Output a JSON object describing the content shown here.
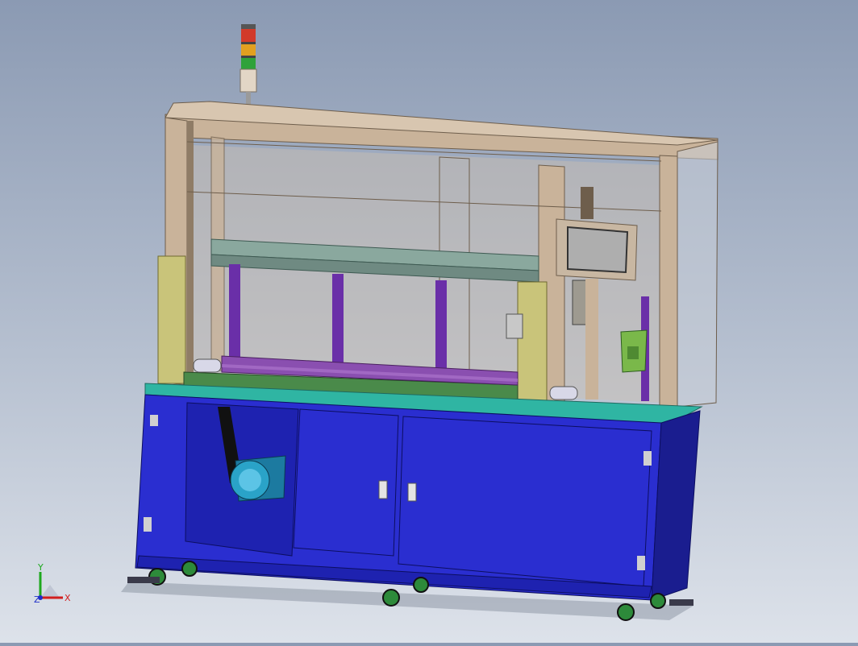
{
  "viewport": {
    "model": "machine-assembly",
    "background": [
      "#8b9ab3",
      "#dde2ea"
    ]
  },
  "colors": {
    "frame": "#c9b39a",
    "frame_dark": "#8f7c66",
    "glass": "rgba(205,190,175,0.45)",
    "cabinet": "#2a2ed0",
    "cabinet_dark": "#1a1d8f",
    "top_plate": "#2fb5a3",
    "conveyor": "#4a8a4a",
    "pillar": "#6a2fa8",
    "rail": "#8aa89e",
    "yellow_post": "#c9c47a",
    "motor": "#2aa3c8",
    "screen": "#aeaeae",
    "wheel": "#2d8a3a",
    "tower_red": "#d23a2a",
    "tower_amber": "#e2a020",
    "tower_green": "#2fa23a"
  },
  "triad": {
    "x": "X",
    "y": "Y",
    "z": "Z"
  }
}
